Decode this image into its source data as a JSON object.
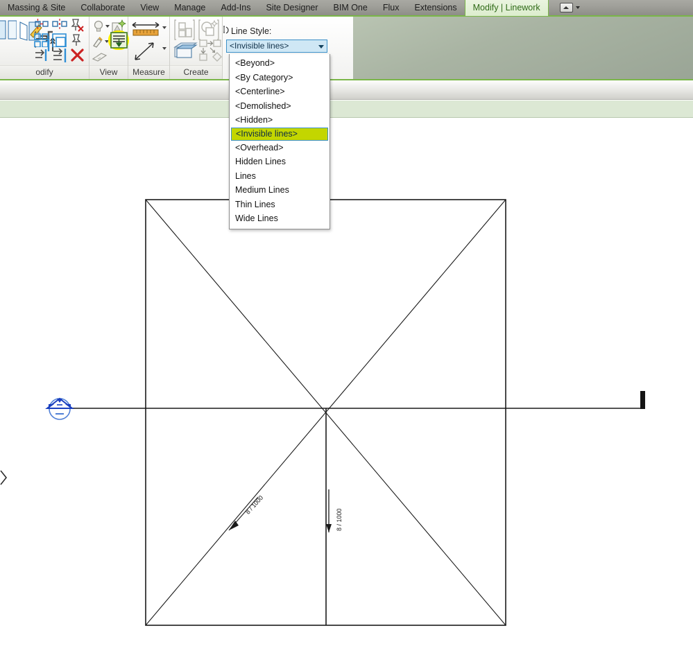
{
  "application": {
    "name": "Autodesk Revit",
    "accent_green": "#7ab648",
    "highlight_yellow": "#c3d600",
    "select_blue": "#3c90c8"
  },
  "ribbon": {
    "tabs": [
      {
        "label": "Massing & Site",
        "active": false
      },
      {
        "label": "Collaborate",
        "active": false
      },
      {
        "label": "View",
        "active": false
      },
      {
        "label": "Manage",
        "active": false
      },
      {
        "label": "Add-Ins",
        "active": false
      },
      {
        "label": "Site Designer",
        "active": false
      },
      {
        "label": "BIM One",
        "active": false
      },
      {
        "label": "Flux",
        "active": false
      },
      {
        "label": "Extensions",
        "active": false
      },
      {
        "label": "Modify | Linework",
        "active": true
      }
    ],
    "tab_overflow_icon": "ribbon-minimize-icon",
    "panels": [
      {
        "name": "modify",
        "label": "odify"
      },
      {
        "name": "view",
        "label": "View"
      },
      {
        "name": "measure",
        "label": "Measure"
      },
      {
        "name": "create",
        "label": "Create"
      }
    ]
  },
  "line_style": {
    "field_label": "Line Style:",
    "label_icon": "linework-icon",
    "selected_value": "<Invisible lines>",
    "dropdown_open": true,
    "options": [
      {
        "label": "<Beyond>",
        "selected": false
      },
      {
        "label": "<By Category>",
        "selected": false
      },
      {
        "label": "<Centerline>",
        "selected": false
      },
      {
        "label": "<Demolished>",
        "selected": false
      },
      {
        "label": "<Hidden>",
        "selected": false
      },
      {
        "label": "<Invisible lines>",
        "selected": true
      },
      {
        "label": "<Overhead>",
        "selected": false
      },
      {
        "label": "Hidden Lines",
        "selected": false
      },
      {
        "label": "Lines",
        "selected": false
      },
      {
        "label": "Medium Lines",
        "selected": false
      },
      {
        "label": "Thin Lines",
        "selected": false
      },
      {
        "label": "Wide Lines",
        "selected": false
      }
    ]
  },
  "toolbar_icons": {
    "modify": [
      "mirror-pick-axis-icon",
      "mirror-draw-axis-icon",
      "move-icon",
      "copy-icon",
      "rotate-icon",
      "pin-delete-icon",
      "array-icon",
      "scale-icon",
      "pin-icon",
      "trim-extend-single-icon",
      "split-icon",
      "align-icon",
      "offset-icon",
      "delete-icon"
    ],
    "view": [
      "reveal-hidden-elements-icon",
      "render-icon",
      "paint-icon",
      "linework-highlight-icon",
      "ray-trace-icon"
    ],
    "measure": [
      "measure-between-references-icon",
      "measure-along-element-icon"
    ],
    "create": [
      "create-similar-icon",
      "create-group-icon",
      "create-part-icon",
      "create-assembly-icon"
    ]
  },
  "drawing": {
    "annotations": [
      {
        "name": "slope-label-diagonal",
        "text": "8 / 1000"
      },
      {
        "name": "slope-label-vertical",
        "text": "8 / 1000"
      }
    ],
    "elements": [
      "roof-outline-square",
      "ridge-diagonal-lines",
      "center-vertical-line",
      "section-marker-left",
      "level-head-line",
      "level-end-tick",
      "view-crop-arrow"
    ],
    "line_color": "#1a1a1a",
    "marker_color": "#1a4cc8"
  }
}
